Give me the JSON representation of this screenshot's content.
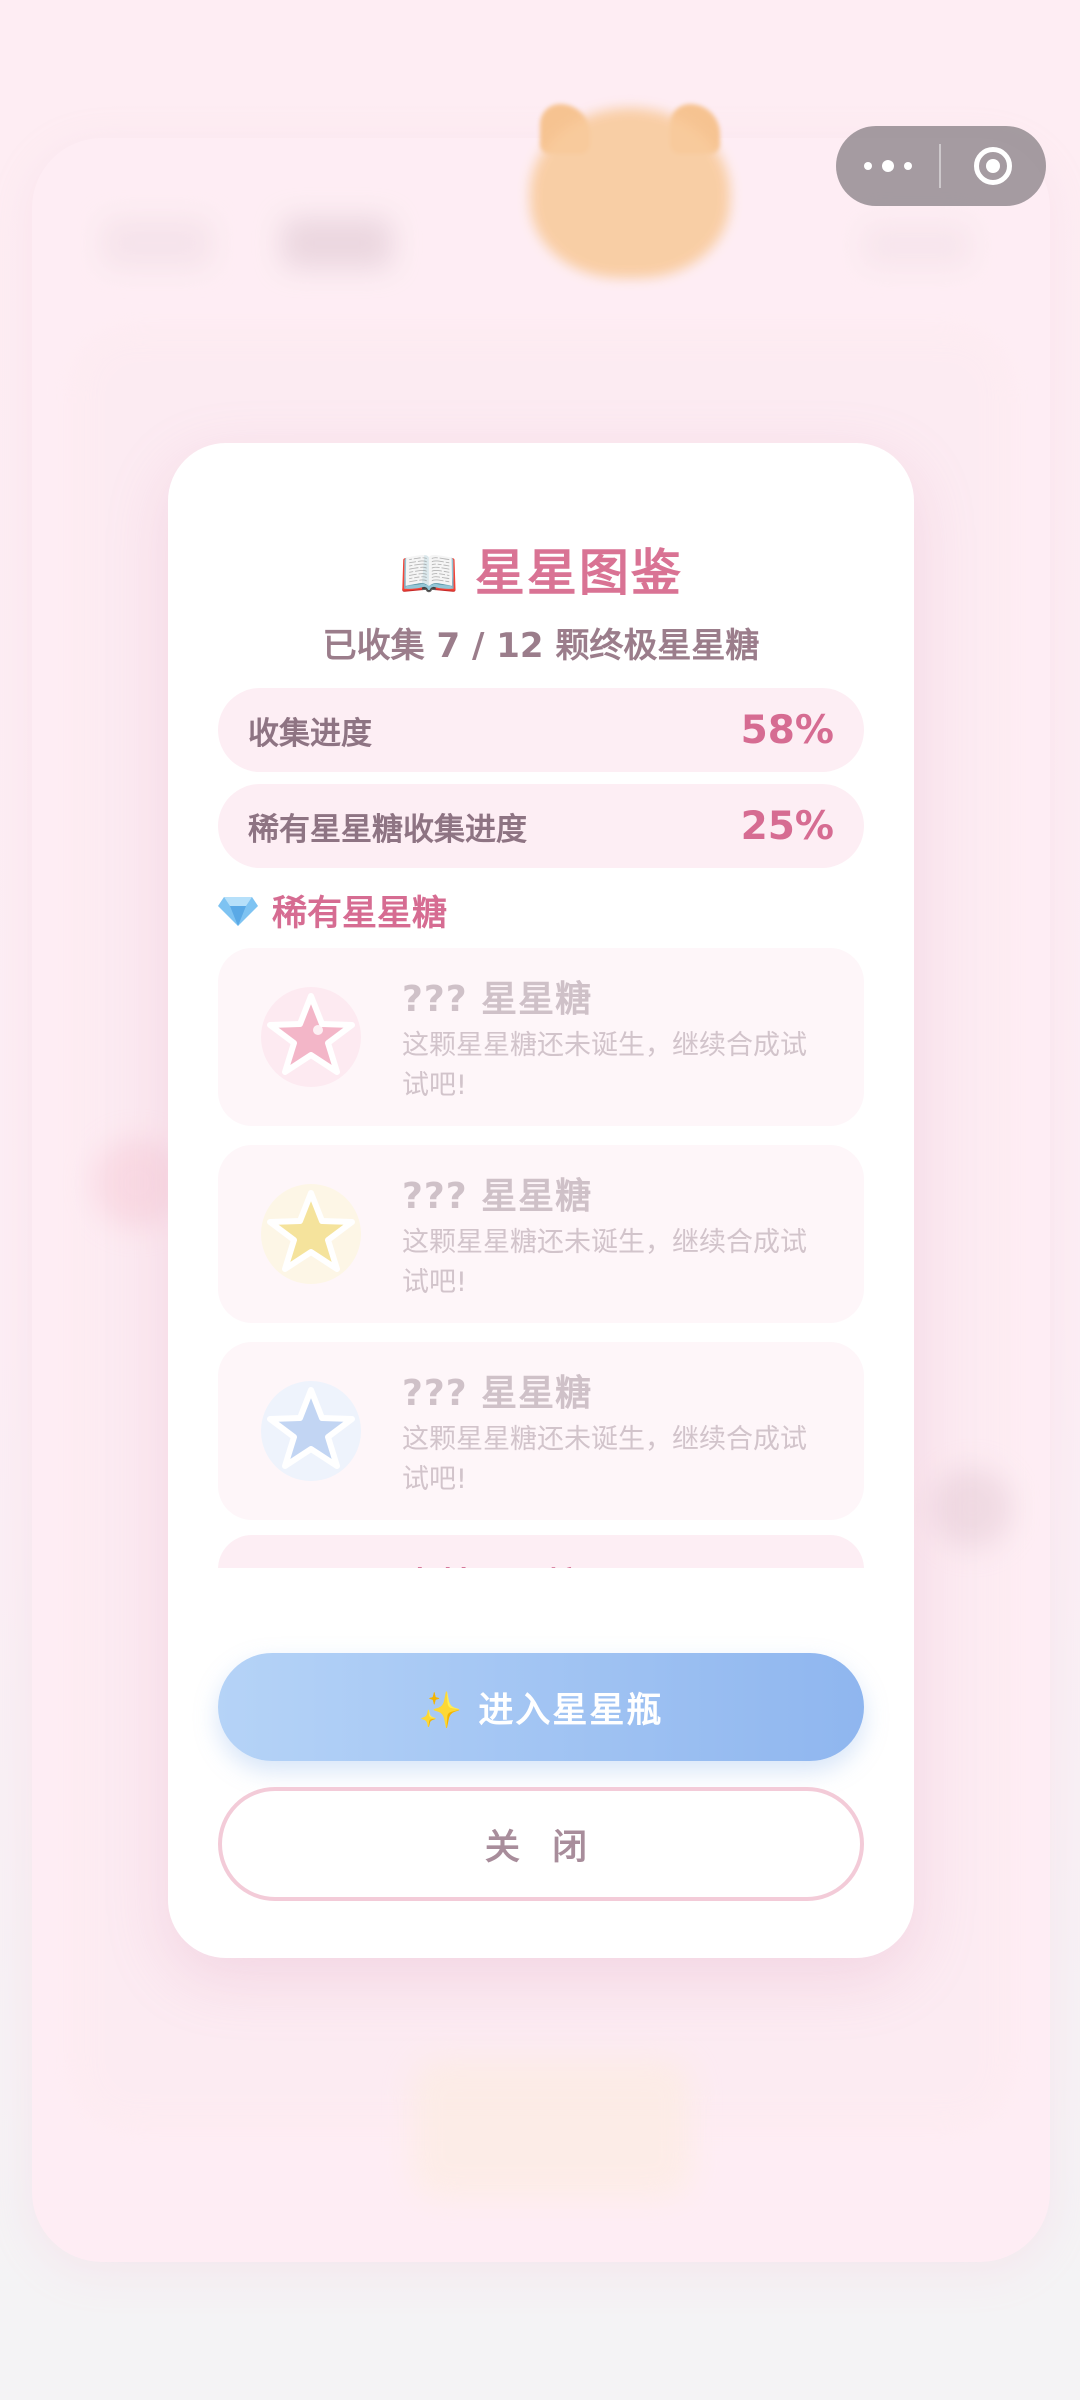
{
  "modal": {
    "title_icon": "open-book-icon",
    "title": "星星图鉴",
    "subtitle": "已收集 7 / 12 颗终极星星糖",
    "progress": [
      {
        "label": "收集进度",
        "value": "58%"
      },
      {
        "label": "稀有星星糖收集进度",
        "value": "25%"
      }
    ],
    "section": {
      "icon": "gem-icon",
      "title": "稀有星星糖"
    },
    "cards": [
      {
        "name": "???  星星糖",
        "desc": "这颗星星糖还未诞生，继续合成试试吧!",
        "star_color": "#f2a9bf",
        "icon": "pink-star-icon"
      },
      {
        "name": "???  星星糖",
        "desc": "这颗星星糖还未诞生，继续合成试试吧!",
        "star_color": "#f4df8a",
        "icon": "yellow-star-icon"
      },
      {
        "name": "???  星星糖",
        "desc": "这颗星星糖还未诞生，继续合成试试吧!",
        "star_color": "#b7cdee",
        "icon": "blue-star-icon"
      }
    ],
    "partial_card": {
      "name": "森林星星糖"
    },
    "enter_button": "✨ 进入星星瓶",
    "close_button": "关 闭"
  },
  "capsule": {
    "more_icon": "more-dots-icon",
    "close_icon": "target-close-icon"
  },
  "colors": {
    "accent_pink": "#d66c92",
    "enter_gradient_start": "#b5d3f7",
    "enter_gradient_end": "#8fb6ef",
    "close_border": "#f3cbd8"
  }
}
